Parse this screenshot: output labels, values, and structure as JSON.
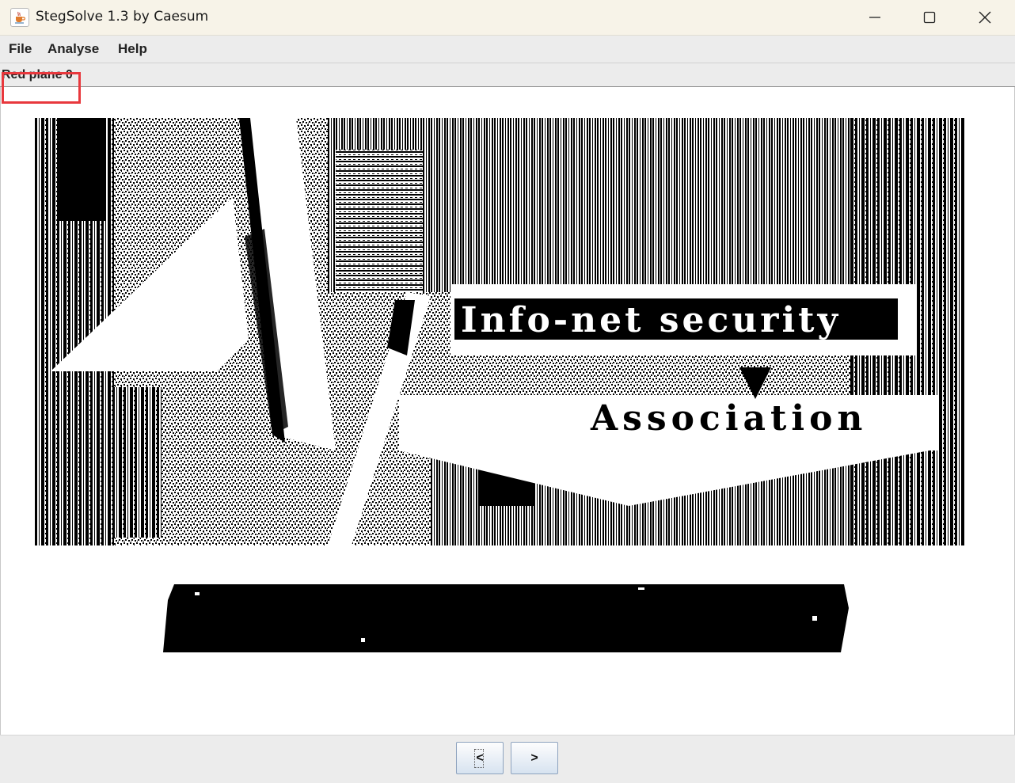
{
  "window": {
    "title": "StegSolve 1.3 by Caesum"
  },
  "menu": {
    "file": "File",
    "analyse": "Analyse",
    "help": "Help"
  },
  "view": {
    "plane_label": "Red plane 0"
  },
  "image": {
    "line1": "Info-net security",
    "line2": "Association"
  },
  "nav": {
    "prev": "<",
    "next": ">"
  },
  "colors": {
    "highlight": "#e8383d",
    "button_border": "#8ea3bf"
  },
  "icons": {
    "app": "java-cup-icon",
    "minimize": "minimize-icon",
    "maximize": "maximize-icon",
    "close": "close-icon"
  }
}
